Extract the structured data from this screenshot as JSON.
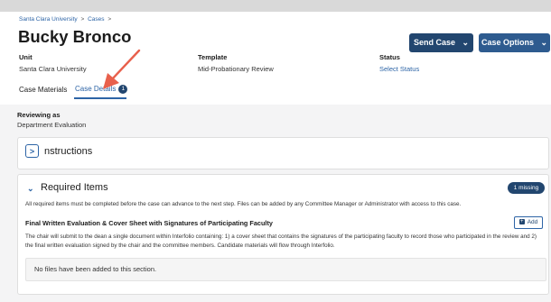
{
  "breadcrumb": {
    "items": [
      "Santa Clara University",
      "Cases"
    ],
    "separator": ">"
  },
  "page": {
    "title": "Bucky Bronco"
  },
  "actions": {
    "send_case": "Send Case",
    "case_options": "Case Options"
  },
  "meta": {
    "unit_label": "Unit",
    "unit_value": "Santa Clara University",
    "template_label": "Template",
    "template_value": "Mid-Probationary Review",
    "status_label": "Status",
    "status_value": "Select Status"
  },
  "tabs": [
    {
      "label": "Case Materials",
      "active": false
    },
    {
      "label": "Case Details",
      "active": true,
      "badge": "1"
    }
  ],
  "reviewing": {
    "label": "Reviewing as",
    "value": "Department Evaluation"
  },
  "instructions": {
    "label": "nstructions"
  },
  "required": {
    "title": "Required Items",
    "badge": "1 missing",
    "description": "All required items must be completed before the case can advance to the next step. Files can be added by any Committee Manager or Administrator with access to this case.",
    "section_title": "Final Written Evaluation & Cover Sheet with Signatures of Participating Faculty",
    "add_label": "Add",
    "section_description": "The chair will submit to the dean a single document within Interfolio containing: 1) a cover sheet that contains the signatures of the participating faculty to record those who participated in the review and 2) the final written evaluation signed by the chair and the committee members. Candidate materials will flow through Interfolio.",
    "empty_text": "No files have been added to this section."
  },
  "colors": {
    "primary": "#22466f",
    "link": "#2d64a6",
    "annotation_arrow": "#e8604c"
  },
  "icons": {
    "chevron_down": "chevron-down-icon",
    "expand": "chevron-right-icon",
    "add": "plus-square-icon",
    "annotation": "red-arrow-annotation"
  }
}
